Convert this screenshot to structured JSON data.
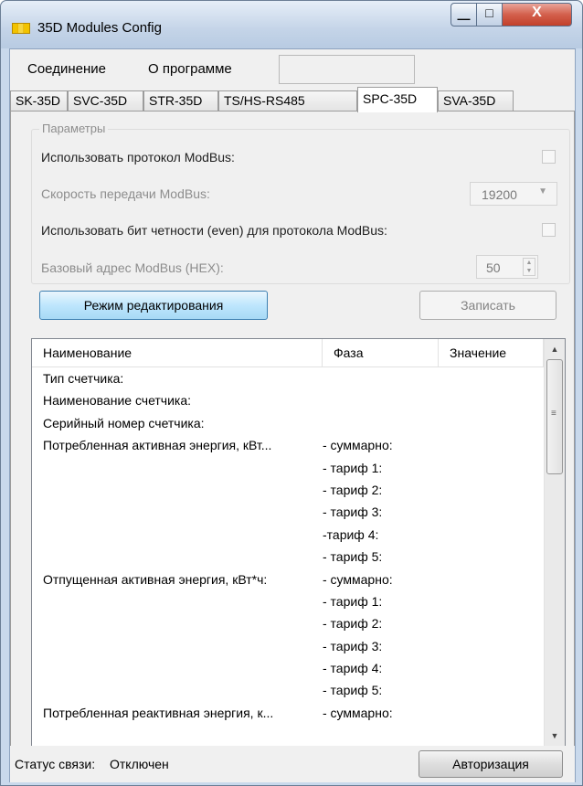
{
  "window": {
    "title": "35D Modules Config",
    "minimize_glyph": "—",
    "maximize_glyph": "□",
    "close_glyph": "X"
  },
  "menu": {
    "items": [
      "Соединение",
      "О программе"
    ]
  },
  "tabs": [
    "SK-35D",
    "SVC-35D",
    "STR-35D",
    "TS/HS-RS485",
    "SPC-35D",
    "SVA-35D"
  ],
  "active_tab": "SPC-35D",
  "parameters": {
    "legend": "Параметры",
    "use_modbus_label": "Использовать  протокол ModBus:",
    "use_modbus_checked": false,
    "baud_label": "Скорость передачи ModBus:",
    "baud_value": "19200",
    "parity_label": "Использовать бит четности (even) для протокола ModBus:",
    "parity_checked": false,
    "address_label": "Базовый адрес ModBus (HEX):",
    "address_value": "50"
  },
  "buttons": {
    "edit_mode": "Режим редактирования",
    "write": "Записать",
    "auth": "Авторизация"
  },
  "table": {
    "columns": [
      "Наименование",
      "Фаза",
      "Значение"
    ],
    "rows": [
      [
        "Тип счетчика:",
        "",
        ""
      ],
      [
        "Наименование счетчика:",
        "",
        ""
      ],
      [
        "Серийный номер счетчика:",
        "",
        ""
      ],
      [
        "Потребленная активная энергия, кВт...",
        " - суммарно:",
        ""
      ],
      [
        "",
        " - тариф 1:",
        ""
      ],
      [
        "",
        " - тариф 2:",
        ""
      ],
      [
        "",
        " - тариф 3:",
        ""
      ],
      [
        "",
        " -тариф 4:",
        ""
      ],
      [
        "",
        " - тариф 5:",
        ""
      ],
      [
        "Отпущенная активная энергия, кВт*ч:",
        " - суммарно:",
        ""
      ],
      [
        "",
        " - тариф 1:",
        ""
      ],
      [
        "",
        " - тариф 2:",
        ""
      ],
      [
        "",
        " - тариф 3:",
        ""
      ],
      [
        "",
        " - тариф 4:",
        ""
      ],
      [
        "",
        " - тариф 5:",
        ""
      ],
      [
        "Потребленная реактивная энергия, к...",
        " - суммарно:",
        ""
      ]
    ],
    "scroll_up": "▲",
    "scroll_down": "▼",
    "scroll_grip": "≡"
  },
  "status": {
    "label": "Статус связи:",
    "value": "Отключен"
  }
}
